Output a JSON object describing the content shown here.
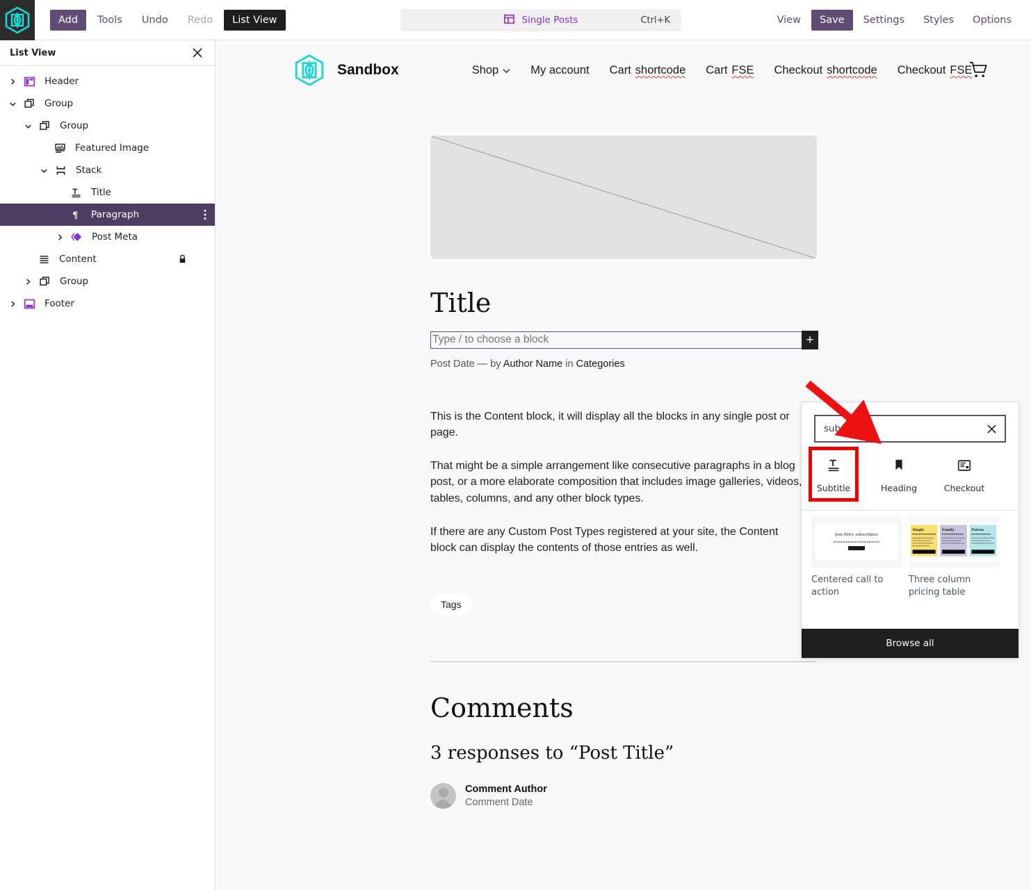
{
  "editor_toolbar": {
    "logo_icon": "wordpress-sandbox-logo-icon",
    "buttons": [
      {
        "label": "Add",
        "style": "filled"
      },
      {
        "label": "Tools",
        "style": "plain"
      },
      {
        "label": "Undo",
        "style": "plain"
      },
      {
        "label": "Redo",
        "style": "disabled"
      },
      {
        "label": "List View",
        "style": "dark"
      }
    ],
    "document_bar": {
      "icon": "template-layout-icon",
      "title": "Single Posts",
      "shortcut": "Ctrl+K"
    },
    "right_buttons": [
      {
        "label": "View",
        "style": "plain"
      },
      {
        "label": "Save",
        "style": "filled"
      },
      {
        "label": "Settings",
        "style": "plain"
      },
      {
        "label": "Styles",
        "style": "plain"
      },
      {
        "label": "Options",
        "style": "plain"
      }
    ]
  },
  "list_view": {
    "title": "List View",
    "close_icon": "close-icon",
    "rows": [
      {
        "label": "Header",
        "icon": "header-block-icon",
        "indent": 0,
        "chevron": "right",
        "selected": false
      },
      {
        "label": "Group",
        "icon": "group-block-icon",
        "indent": 0,
        "chevron": "down",
        "selected": false
      },
      {
        "label": "Group",
        "icon": "group-block-icon",
        "indent": 1,
        "chevron": "down",
        "selected": false
      },
      {
        "label": "Featured Image",
        "icon": "featured-image-icon",
        "indent": 2,
        "chevron": "none",
        "selected": false
      },
      {
        "label": "Stack",
        "icon": "stack-block-icon",
        "indent": 2,
        "chevron": "down",
        "selected": false
      },
      {
        "label": "Title",
        "icon": "title-block-icon",
        "indent": 3,
        "chevron": "none",
        "selected": false
      },
      {
        "label": "Paragraph",
        "icon": "paragraph-block-icon",
        "indent": 3,
        "chevron": "none",
        "selected": true,
        "options_icon": "more-options-icon"
      },
      {
        "label": "Post Meta",
        "icon": "post-meta-icon",
        "indent": 2,
        "chevron": "right",
        "selected": false
      },
      {
        "label": "Content",
        "icon": "content-block-icon",
        "indent": 1,
        "chevron": "none",
        "selected": false,
        "lock_icon": "lock-icon"
      },
      {
        "label": "Group",
        "icon": "group-block-icon",
        "indent": 1,
        "chevron": "right",
        "selected": false
      },
      {
        "label": "Footer",
        "icon": "footer-block-icon",
        "indent": 0,
        "chevron": "right",
        "selected": false
      }
    ]
  },
  "site": {
    "logo_icon": "sandbox-hex-logo-icon",
    "name": "Sandbox",
    "nav": [
      {
        "label": "Shop",
        "has_chevron": true,
        "misspelled": false
      },
      {
        "label": "My account",
        "has_chevron": false,
        "misspelled": false
      },
      {
        "label": "Cart ",
        "suffix": "shortcode",
        "has_chevron": false,
        "misspelled": true
      },
      {
        "label": "Cart ",
        "suffix": "FSE",
        "has_chevron": false,
        "misspelled": true
      },
      {
        "label": "Checkout ",
        "suffix": "shortcode",
        "has_chevron": false,
        "misspelled": true
      },
      {
        "label": "Checkout ",
        "suffix": "FSE",
        "has_chevron": false,
        "misspelled": true
      }
    ],
    "cart_icon": "shopping-cart-icon"
  },
  "post": {
    "featured_image_placeholder": "featured-image-placeholder",
    "title": "Title",
    "paragraph_placeholder": "Type / to choose a block",
    "add_block_icon": "plus-icon",
    "meta": {
      "date": "Post Date",
      "dash": "—",
      "by": "by",
      "author": "Author Name",
      "in": "in",
      "categories": "Categories"
    },
    "content_paragraphs": [
      "This is the Content block, it will display all the blocks in any single post or page.",
      "That might be a simple arrangement like consecutive paragraphs in a blog post, or a more elaborate composition that includes image galleries, videos, tables, columns, and any other block types.",
      "If there are any Custom Post Types registered at your site, the Content block can display the contents of those entries as well."
    ],
    "tag": "Tags",
    "comments_heading": "Comments",
    "responses_heading": "3 responses to “Post Title”",
    "comment": {
      "avatar": "avatar",
      "author": "Comment Author",
      "date": "Comment Date"
    }
  },
  "inserter": {
    "search_value": "sub",
    "clear_icon": "close-icon",
    "blocks": [
      {
        "label": "Subtitle",
        "icon": "subtitle-block-icon",
        "highlighted": true
      },
      {
        "label": "Heading",
        "icon": "heading-bookmark-icon",
        "highlighted": false
      },
      {
        "label": "Checkout",
        "icon": "checkout-block-icon",
        "highlighted": false
      }
    ],
    "patterns": [
      {
        "label": "Centered call to action",
        "thumb": "centered-cta-thumbnail",
        "heading": "Join 900+ subscribers"
      },
      {
        "label": "Three column pricing table",
        "thumb": "pricing-table-thumbnail",
        "columns": [
          "Single",
          "Family",
          "Patron"
        ]
      }
    ],
    "browse_all": "Browse all"
  },
  "annotation": {
    "arrow": "red-arrow-pointing-to-search-field",
    "arrow_color": "#ee1111",
    "highlight_color": "#ee0000"
  }
}
